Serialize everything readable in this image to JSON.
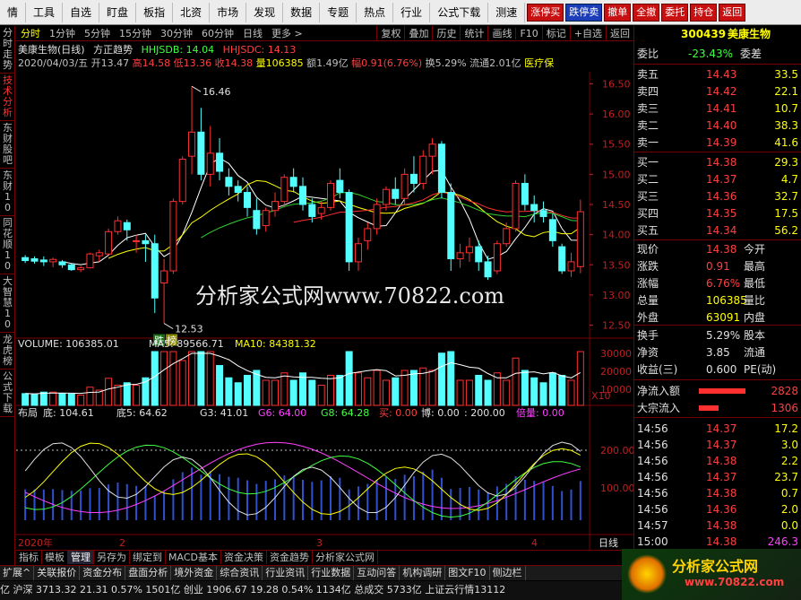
{
  "menu": {
    "items": [
      "情",
      "工具",
      "自选",
      "盯盘",
      "板指",
      "北资",
      "市场",
      "发现",
      "数据",
      "专题",
      "热点",
      "行业",
      "公式下载",
      "测速"
    ],
    "buttons": [
      "涨停买",
      "跌停卖",
      "撤单",
      "全撤",
      "委托",
      "持仓",
      "返回"
    ]
  },
  "left_tabs": [
    "分时走势",
    "技术分析",
    "东财股吧",
    "东财10",
    "同花顺10",
    "大智慧10",
    "龙虎榜",
    "公式下载"
  ],
  "chart_header": {
    "periods": [
      "分时",
      "1分钟",
      "5分钟",
      "15分钟",
      "30分钟",
      "60分钟",
      "日线",
      "更多 >"
    ],
    "active": "分时",
    "tools": [
      "复权",
      "叠加",
      "历史",
      "统计",
      "画线",
      "F10",
      "标记",
      "+自选",
      "返回"
    ]
  },
  "info": {
    "name": "美康生物(日线)",
    "indicator": "方正趋势",
    "hhjsdb": "HHJSDB: 14.04",
    "hhjsdc": "HHJSDC: 14.13",
    "date": "2020/04/03/五",
    "open": "开13.47",
    "high": "高14.58",
    "low": "低13.36",
    "close": "收14.38",
    "volume": "量106385",
    "amount": "额1.49亿",
    "amp": "幅0.91(6.76%)",
    "turnover": "换5.29%",
    "float": "流通2.01亿",
    "sector": "医疗保"
  },
  "price_axis": [
    "16.50",
    "16.00",
    "15.50",
    "15.00",
    "14.50",
    "14.00",
    "13.50",
    "13.00",
    "12.50"
  ],
  "price_max_label": "16.46",
  "price_min_label": "12.53",
  "markers": {
    "die": "跌",
    "bang": "榜"
  },
  "volume_line": {
    "label": "VOLUME: 106385.01",
    "ma5": "MA5: 89566.71",
    "ma10": "MA10: 84381.32"
  },
  "volume_axis": [
    "30000",
    "20000",
    "10000"
  ],
  "vol_unit": "X10",
  "bottom_ind": {
    "name": "布局",
    "di": "底: 104.61",
    "di5": "底5: 64.62",
    "g3": "G3: 41.01",
    "g6": "G6: 64.00",
    "g8": "G8: 64.28",
    "buy": "买: 0.00",
    "bo": "博: 0.00",
    "val": ": 200.00",
    "bei": "倍量: 0.00"
  },
  "ind_axis": [
    "200.00",
    "100.00"
  ],
  "x_labels": [
    "2020年",
    "2",
    "3",
    "4"
  ],
  "period_label": "日线",
  "watermark": "分析家公式网www.70822.com",
  "right": {
    "code": "300439",
    "name": "美康生物",
    "weibi": "委比",
    "weibi_val": "-23.43%",
    "weicha": "委差",
    "sells": [
      {
        "l": "卖五",
        "p": "14.43",
        "v": "33.5"
      },
      {
        "l": "卖四",
        "p": "14.42",
        "v": "22.1"
      },
      {
        "l": "卖三",
        "p": "14.41",
        "v": "10.7"
      },
      {
        "l": "卖二",
        "p": "14.40",
        "v": "38.3"
      },
      {
        "l": "卖一",
        "p": "14.39",
        "v": "41.6"
      }
    ],
    "buys": [
      {
        "l": "买一",
        "p": "14.38",
        "v": "29.3"
      },
      {
        "l": "买二",
        "p": "14.37",
        "v": "4.7"
      },
      {
        "l": "买三",
        "p": "14.36",
        "v": "32.7"
      },
      {
        "l": "买四",
        "p": "14.35",
        "v": "17.5"
      },
      {
        "l": "买五",
        "p": "14.34",
        "v": "56.2"
      }
    ],
    "stats": [
      {
        "l": "现价",
        "v": "14.38",
        "r": "今开"
      },
      {
        "l": "涨跌",
        "v": "0.91",
        "r": "最高"
      },
      {
        "l": "涨幅",
        "v": "6.76%",
        "r": "最低"
      },
      {
        "l": "总量",
        "v": "106385",
        "r": "量比"
      },
      {
        "l": "外盘",
        "v": "63091",
        "r": "内盘"
      }
    ],
    "stats2": [
      {
        "l": "换手",
        "v": "5.29%",
        "r": "股本"
      },
      {
        "l": "净资",
        "v": "3.85",
        "r": "流通"
      },
      {
        "l": "收益(三)",
        "v": "0.600",
        "r": "PE(动)"
      }
    ],
    "flows": [
      {
        "l": "净流入额",
        "v": "2828"
      },
      {
        "l": "大宗流入",
        "v": "1306"
      }
    ],
    "ticks": [
      {
        "t": "14:56",
        "p": "14.37",
        "v": "17.2"
      },
      {
        "t": "14:56",
        "p": "14.37",
        "v": "3.0"
      },
      {
        "t": "14:56",
        "p": "14.38",
        "v": "2.2"
      },
      {
        "t": "14:56",
        "p": "14.37",
        "v": "23.7"
      },
      {
        "t": "14:56",
        "p": "14.38",
        "v": "0.7"
      },
      {
        "t": "14:56",
        "p": "14.36",
        "v": "2.0"
      },
      {
        "t": "14:57",
        "p": "14.38",
        "v": "0.0"
      },
      {
        "t": "15:00",
        "p": "14.38",
        "v": "246.3"
      }
    ]
  },
  "bottom_tabs": [
    "指标",
    "模板",
    "管理",
    "另存为",
    "绑定到",
    "MACD基本",
    "资金决策",
    "资金趋势",
    "分析家公式网"
  ],
  "bottom_bar": [
    "扩展^",
    "关联报价",
    "资金分布",
    "盘面分析",
    "境外资金",
    "综合资讯",
    "行业资讯",
    "行业数据",
    "互动问答",
    "机构调研",
    "图文F10",
    "侧边栏"
  ],
  "status": "亿 沪深 3713.32 21.31 0.57% 1501亿   创业 1906.67 19.28 0.54% 1134亿   总成交 5733亿   上证云行情13112",
  "logo": "分析家公式网",
  "logo_url": "www.70822.com",
  "chart_data": {
    "type": "candlestick",
    "ylim": [
      12.3,
      16.7
    ],
    "ohlc": [
      [
        13.62,
        13.66,
        13.53,
        13.57
      ],
      [
        13.6,
        13.64,
        13.52,
        13.56
      ],
      [
        13.58,
        13.64,
        13.48,
        13.55
      ],
      [
        13.55,
        13.62,
        13.46,
        13.59
      ],
      [
        13.55,
        13.58,
        13.45,
        13.5
      ],
      [
        13.5,
        13.52,
        13.4,
        13.42
      ],
      [
        13.42,
        13.48,
        13.38,
        13.45
      ],
      [
        13.45,
        13.7,
        13.44,
        13.68
      ],
      [
        13.65,
        13.75,
        13.55,
        13.7
      ],
      [
        13.68,
        14.1,
        13.66,
        14.05
      ],
      [
        14.05,
        14.3,
        14.0,
        14.23
      ],
      [
        14.2,
        14.25,
        13.9,
        14.08
      ],
      [
        13.9,
        14.0,
        13.7,
        13.9
      ],
      [
        13.9,
        14.0,
        13.55,
        13.85
      ],
      [
        13.85,
        14.0,
        12.7,
        12.95
      ],
      [
        13.2,
        13.6,
        12.53,
        13.4
      ],
      [
        13.4,
        14.6,
        13.35,
        14.55
      ],
      [
        14.55,
        15.3,
        14.5,
        15.25
      ],
      [
        15.3,
        16.46,
        15.0,
        15.7
      ],
      [
        15.7,
        16.1,
        14.9,
        15.0
      ],
      [
        15.0,
        15.8,
        14.8,
        15.35
      ],
      [
        15.35,
        15.6,
        14.9,
        15.05
      ],
      [
        14.95,
        15.1,
        14.65,
        14.8
      ],
      [
        14.8,
        14.9,
        14.55,
        14.7
      ],
      [
        14.7,
        14.8,
        14.3,
        14.45
      ],
      [
        14.4,
        14.6,
        14.0,
        14.1
      ],
      [
        14.15,
        14.45,
        14.05,
        14.4
      ],
      [
        14.4,
        14.7,
        14.3,
        14.55
      ],
      [
        14.55,
        15.0,
        14.45,
        14.95
      ],
      [
        14.95,
        15.1,
        14.7,
        14.8
      ],
      [
        14.8,
        14.95,
        14.4,
        14.5
      ],
      [
        14.5,
        14.6,
        14.2,
        14.3
      ],
      [
        14.35,
        14.55,
        14.25,
        14.45
      ],
      [
        14.45,
        14.9,
        14.4,
        14.85
      ],
      [
        14.9,
        15.1,
        14.6,
        14.7
      ],
      [
        14.7,
        14.75,
        13.4,
        13.55
      ],
      [
        13.55,
        13.95,
        13.4,
        13.85
      ],
      [
        13.9,
        14.2,
        13.75,
        14.1
      ],
      [
        14.1,
        14.6,
        14.0,
        14.5
      ],
      [
        14.5,
        14.8,
        14.4,
        14.75
      ],
      [
        14.75,
        14.95,
        14.5,
        14.6
      ],
      [
        14.6,
        15.1,
        14.5,
        15.0
      ],
      [
        15.0,
        15.3,
        14.7,
        14.85
      ],
      [
        14.85,
        15.4,
        14.75,
        15.3
      ],
      [
        15.3,
        15.6,
        15.0,
        15.5
      ],
      [
        15.5,
        15.55,
        14.6,
        14.7
      ],
      [
        14.7,
        14.85,
        13.4,
        13.6
      ],
      [
        13.6,
        13.85,
        13.45,
        13.7
      ],
      [
        13.7,
        13.95,
        13.55,
        13.8
      ],
      [
        13.8,
        13.9,
        13.4,
        13.55
      ],
      [
        13.55,
        13.65,
        13.25,
        13.3
      ],
      [
        13.4,
        13.9,
        13.35,
        13.85
      ],
      [
        13.85,
        14.2,
        13.8,
        14.1
      ],
      [
        14.1,
        14.9,
        14.05,
        14.85
      ],
      [
        14.85,
        15.0,
        14.4,
        14.5
      ],
      [
        14.5,
        14.65,
        14.2,
        14.4
      ],
      [
        14.4,
        14.55,
        14.2,
        14.3
      ],
      [
        14.25,
        14.35,
        13.8,
        13.9
      ],
      [
        13.8,
        13.85,
        13.35,
        13.4
      ],
      [
        13.4,
        13.7,
        13.3,
        13.55
      ],
      [
        13.47,
        14.58,
        13.36,
        14.38
      ]
    ]
  }
}
